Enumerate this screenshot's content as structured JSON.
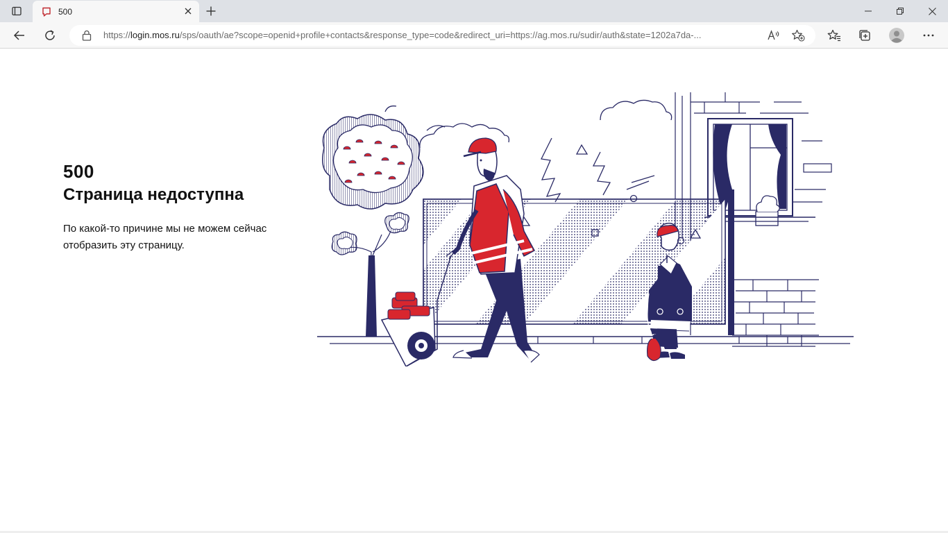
{
  "browser": {
    "tab": {
      "title": "500",
      "favicon": "page-icon",
      "close_icon": "close-icon"
    },
    "new_tab_icon": "plus-icon",
    "window_controls": [
      "minimize-icon",
      "restore-icon",
      "close-icon"
    ],
    "toolbar": {
      "back_icon": "back-arrow-icon",
      "refresh_icon": "refresh-icon",
      "address": {
        "lock_icon": "lock-icon",
        "scheme": "https://",
        "host": "login.mos.ru",
        "path": "/sps/oauth/ae?scope=openid+profile+contacts&response_type=code&redirect_uri=https://ag.mos.ru/sudir/auth&state=1202a7da-..."
      },
      "read_aloud_icon": "read-aloud-icon",
      "add_favorite_icon": "add-favorite-icon",
      "favorites_icon": "favorites-icon",
      "collections_icon": "collections-icon",
      "profile_icon": "profile-avatar-icon",
      "menu_icon": "more-dots-icon"
    }
  },
  "page": {
    "code": "500",
    "title": "Страница недоступна",
    "message": "По какой-то причине мы не можем сейчас отобразить эту страницу."
  },
  "colors": {
    "navy": "#2a2a66",
    "red": "#d8262e",
    "tabstrip": "#dee1e6",
    "toolbar": "#f7f7f7"
  }
}
